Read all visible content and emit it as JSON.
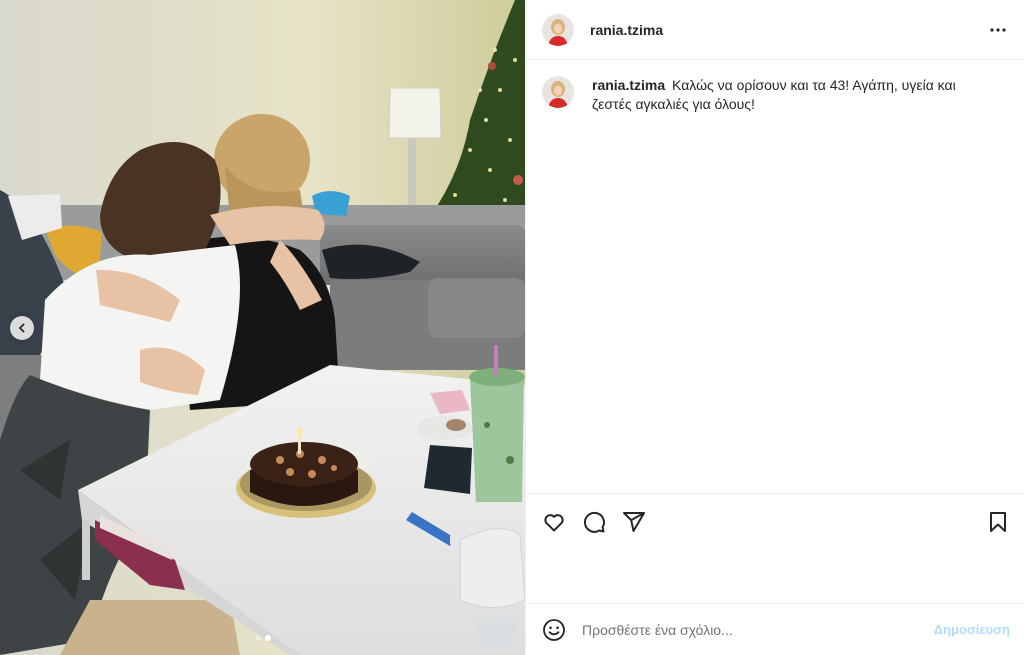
{
  "header": {
    "username": "rania.tzima"
  },
  "caption": {
    "username": "rania.tzima",
    "text": "Καλώς να ορίσουν και τα 43! Αγάπη, υγεία και ζεστές αγκαλιές για όλους!"
  },
  "carousel": {
    "slide_count": 2,
    "active_slide": 2
  },
  "actions": {
    "icons": [
      "heart-icon",
      "comment-icon",
      "share-icon",
      "bookmark-icon"
    ]
  },
  "comment_box": {
    "placeholder": "Προσθέστε ένα σχόλιο...",
    "post_label": "Δημοσίευση"
  },
  "colors": {
    "post_button_disabled": "#b3dbff",
    "text": "#262626",
    "border": "#efefef"
  }
}
